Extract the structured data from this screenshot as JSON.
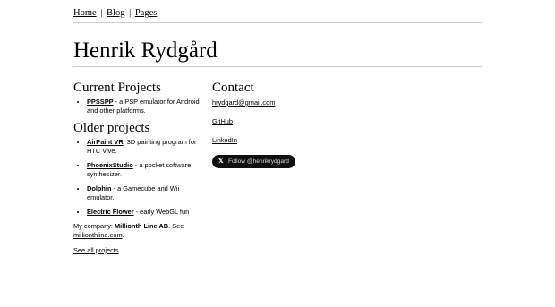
{
  "nav": {
    "items": [
      {
        "label": "Home"
      },
      {
        "label": "Blog"
      },
      {
        "label": "Pages"
      }
    ],
    "separator": "|"
  },
  "site_title": "Henrik Rydgård",
  "current_projects": {
    "heading": "Current Projects",
    "items": [
      {
        "name": "PPSSPP",
        "desc": " - a PSP emulator for Android and other platforms."
      }
    ]
  },
  "older_projects": {
    "heading": "Older projects",
    "items": [
      {
        "name": "AirPaint VR",
        "desc": ": 3D painting program for HTC Vive."
      },
      {
        "name": "PhoenixStudio",
        "desc": " - a pocket software synthesizer."
      },
      {
        "name": "Dolphin",
        "desc": " - a Gamecube and Wii emulator."
      },
      {
        "name": "Electric Flower",
        "desc": " - early WebGL fun"
      }
    ]
  },
  "company": {
    "prefix": "My company: ",
    "name": "Millionth Line AB",
    "mid": ". See ",
    "link": "millionthline.com",
    "suffix": "."
  },
  "see_all": "See all projects",
  "contact": {
    "heading": "Contact",
    "email": "hrydgard@gmail.com",
    "github": "GitHub",
    "linkedin": "LinkedIn",
    "follow_label": "Follow @henrikrydgard",
    "follow_icon": "x-logo-icon"
  },
  "colors": {
    "follow_bg": "#0f0f0f",
    "rule": "#cfcfcf"
  }
}
